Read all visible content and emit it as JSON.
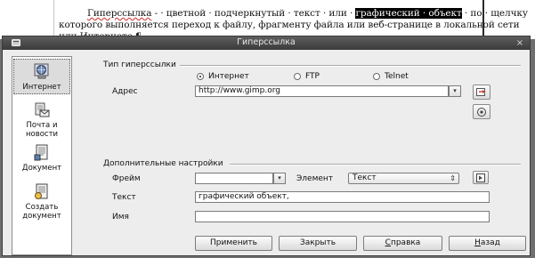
{
  "document": {
    "line1_a": "Гиперссылка",
    "line1_b": " - · цветной · подчеркнутый · текст · или · ",
    "line1_sel": "графический · объект",
    "line1_c": " · по · щелчку",
    "line2": "которого выполняется переход к файлу, фрагменту файла или веб-странице в локальной сети",
    "line3": "или Интернете.¶"
  },
  "dialog": {
    "title": "Гиперссылка",
    "close_glyph": "×"
  },
  "sidebar": {
    "items": [
      {
        "label_1": "Интернет",
        "label_2": ""
      },
      {
        "label_1": "Почта и",
        "label_2": "новости"
      },
      {
        "label_1": "Документ",
        "label_2": ""
      },
      {
        "label_1": "Создать",
        "label_2": "документ"
      }
    ]
  },
  "hyperlink_type": {
    "section_title": "Тип гиперссылки",
    "options": [
      "Интернет",
      "FTP",
      "Telnet"
    ],
    "selected": "Интернет",
    "address_label": "Адрес",
    "address_value": "http://www.gimp.org"
  },
  "more_settings": {
    "section_title": "Дополнительные настройки",
    "frame_label": "Фрейм",
    "frame_value": "",
    "element_label": "Элемент",
    "element_value": "Текст",
    "text_label": "Текст",
    "text_value": "графический объект,",
    "name_label": "Имя",
    "name_value": ""
  },
  "buttons": {
    "apply": "Применить",
    "close": "Закрыть",
    "help_first": "С",
    "help_rest": "правка",
    "back_first": "Н",
    "back_rest": "азад"
  }
}
